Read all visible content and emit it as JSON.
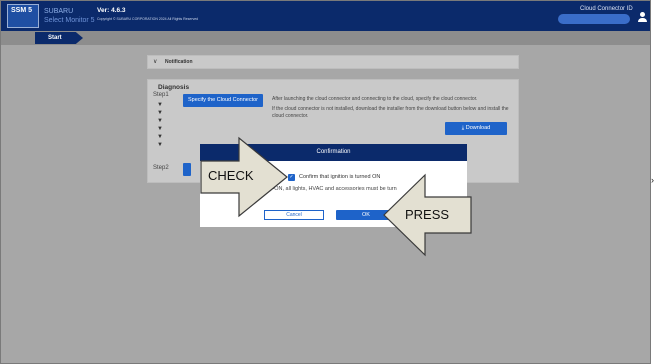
{
  "header": {
    "logo_text": "SSM 5",
    "brand_line1": "SUBARU",
    "brand_line2": "Select Monitor 5",
    "version": "Ver: 4.6.3",
    "copyright": "Copyright © SUBARU CORPORATION 2024 All Rights Reserved",
    "cloud_connector_label": "Cloud Connector ID",
    "cloud_connector_value": ""
  },
  "breadcrumb": {
    "start_label": "Start"
  },
  "notification": {
    "label": "Notification"
  },
  "diagnosis": {
    "title": "Diagnosis",
    "step1_label": "Step1",
    "step2_label": "Step2",
    "specify_button": "Specify the Cloud Connector",
    "desc1": "After launching the cloud connector and connecting to the cloud, specify the cloud connector.",
    "desc2": "If the cloud connector is not installed, download the installer from the download button below and install the cloud connector.",
    "download_button": "Download",
    "download_icon": "download-icon"
  },
  "modal": {
    "title": "Confirmation",
    "checkbox_label": "Confirm that ignition is turned ON",
    "checkbox_checked": true,
    "note": "g IG-ON, all lights, HVAC and accessories must be turn",
    "cancel_label": "Cancel",
    "ok_label": "OK"
  },
  "callouts": {
    "check_text": "CHECK",
    "press_text": "PRESS"
  },
  "colors": {
    "header_bg": "#0b2a6b",
    "accent_blue": "#1e63c9",
    "overlay_gray": "#a7a7a7",
    "callout_fill": "#e3e0d2"
  }
}
